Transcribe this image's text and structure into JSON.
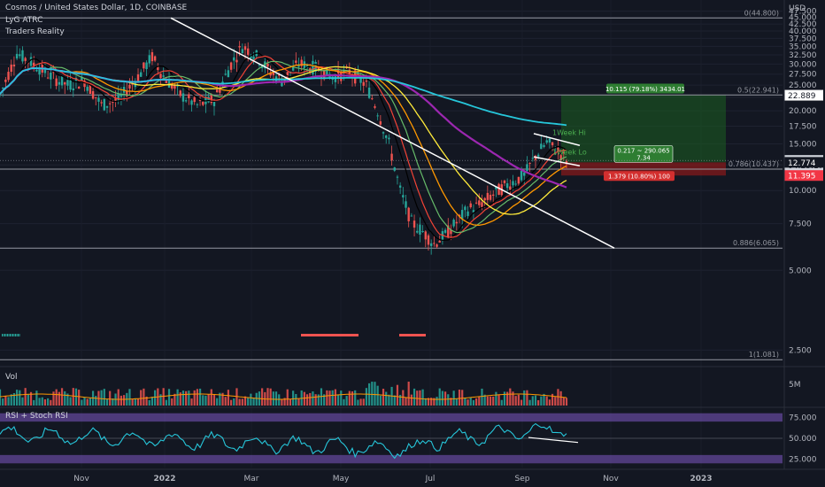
{
  "header": {
    "symbol_line": "Cosmos / United States Dollar, 1D, COINBASE",
    "indicator_1": "LyG ATRC",
    "indicator_2": "Traders Reality"
  },
  "currency": "USD",
  "chart_data": [
    {
      "type": "candlestick",
      "title": "Cosmos / United States Dollar, 1D, COINBASE",
      "scale": "log",
      "ylim": [
        2.2,
        50
      ],
      "y_ticks": [
        2.5,
        5.0,
        7.5,
        10.0,
        12.5,
        15.0,
        17.5,
        20.0,
        22.5,
        25.0,
        27.5,
        30.0,
        32.5,
        35.0,
        37.5,
        40.0,
        42.5,
        45.0,
        47.5
      ],
      "y_tick_labels": [
        "2.500",
        "5.000",
        "7.500",
        "10.000",
        "12.500",
        "15.000",
        "17.500",
        "20.000",
        "22.500",
        "25.000",
        "27.500",
        "30.000",
        "32.500",
        "35.000",
        "37.500",
        "40.000",
        "42.500",
        "45.000",
        "47.500"
      ],
      "x_ticks": [
        "Nov",
        "2022",
        "Mar",
        "May",
        "Jul",
        "Sep",
        "Nov",
        "2023"
      ],
      "fib_levels": [
        {
          "label": "0(44.800)",
          "value": 44.8
        },
        {
          "label": "0.5(22.941)",
          "value": 22.941
        },
        {
          "label": "0.786(10.437)",
          "value": 12.05
        },
        {
          "label": "0.886(6.065)",
          "value": 6.065
        },
        {
          "label": "1(1.081)",
          "value": 2.3
        }
      ],
      "price_badges": [
        {
          "label": "22.889",
          "value": 22.889,
          "color": "#ffffff",
          "text_color": "#131722"
        },
        {
          "label": "12.991",
          "value": 12.991,
          "color": "#d1d4dc",
          "text_color": "#131722"
        },
        {
          "label": "04:25:17",
          "value": 12.45,
          "color": "#d1d4dc",
          "text_color": "#131722"
        },
        {
          "label": "12.774",
          "value": 12.774,
          "color": "#131722",
          "text_color": "#ffffff"
        },
        {
          "label": "11.395",
          "value": 11.395,
          "color": "#f23645",
          "text_color": "#ffffff"
        }
      ],
      "position": {
        "entry": 12.774,
        "target": 22.889,
        "stop": 11.395,
        "target_label": "10.115 (79.18%) 3434.01",
        "stop_label": "1.379 (10.80%) 100",
        "ratio_label_1": "0.217 ~ 290.065",
        "ratio_label_2": "7.34"
      },
      "annotations": [
        "1Week Hi",
        "1Week Lo"
      ],
      "price_path": [
        [
          0,
          23
        ],
        [
          6,
          33
        ],
        [
          12,
          30
        ],
        [
          18,
          27
        ],
        [
          24,
          25
        ],
        [
          30,
          26
        ],
        [
          36,
          21
        ],
        [
          42,
          22
        ],
        [
          48,
          26
        ],
        [
          54,
          32
        ],
        [
          58,
          27
        ],
        [
          64,
          23
        ],
        [
          70,
          21
        ],
        [
          76,
          22
        ],
        [
          82,
          30
        ],
        [
          86,
          35
        ],
        [
          90,
          33
        ],
        [
          96,
          28
        ],
        [
          100,
          26
        ],
        [
          106,
          30
        ],
        [
          112,
          29
        ],
        [
          118,
          27
        ],
        [
          124,
          28
        ],
        [
          130,
          25
        ],
        [
          134,
          20
        ],
        [
          138,
          15
        ],
        [
          142,
          10
        ],
        [
          146,
          7.6
        ],
        [
          150,
          7
        ],
        [
          154,
          6.3
        ],
        [
          158,
          6.8
        ],
        [
          162,
          7.6
        ],
        [
          166,
          8.5
        ],
        [
          170,
          8.8
        ],
        [
          174,
          9.5
        ],
        [
          178,
          10.2
        ],
        [
          182,
          10.8
        ],
        [
          186,
          11.4
        ],
        [
          190,
          13.5
        ],
        [
          194,
          15.2
        ],
        [
          198,
          14.1
        ],
        [
          201,
          12.99
        ]
      ]
    },
    {
      "type": "bar",
      "title": "Vol",
      "y_tick_labels": [
        "5M"
      ]
    },
    {
      "type": "line",
      "title": "RSI + Stoch RSI",
      "ylim": [
        15,
        85
      ],
      "y_ticks": [
        25,
        50,
        75
      ],
      "y_tick_labels": [
        "25.000",
        "50.000",
        "75.000"
      ]
    }
  ],
  "colors": {
    "background": "#131722",
    "up": "#26a69a",
    "down": "#ef5350",
    "ma_purple": "#9c27b0",
    "ma_cyan": "#26c6da",
    "ma_yellow": "#ffeb3b",
    "ma_orange": "#ff9800",
    "ma_red": "#f44336",
    "rsi_line": "#2196f3",
    "band": "#7e57c2",
    "target_zone": "#1b5e20",
    "stop_zone": "#8b1a1a"
  }
}
